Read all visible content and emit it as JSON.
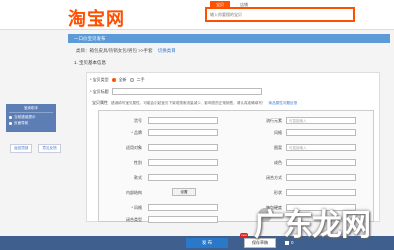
{
  "header": {
    "logo": "淘宝网",
    "search_tabs": [
      "宝贝",
      "店铺"
    ],
    "search_placeholder": "输入你要搜的宝贝"
  },
  "bluebar": {
    "title": "一口价宝贝发布"
  },
  "breadcrumb": {
    "text": "类目：箱包皮具/热销女包/男包 >>手套",
    "link": "切换类目"
  },
  "section": {
    "title": "1. 宝贝基本信息"
  },
  "leftnav": {
    "title": "宝卖助手",
    "items": [
      "当前错误提示",
      "页面导航"
    ]
  },
  "sidebtns": [
    "返回顶部",
    "意见反馈"
  ],
  "form": {
    "type_label": "* 宝贝类型",
    "type_options": [
      "全新",
      "二手"
    ],
    "title_label": "* 宝贝标题",
    "attr_label": "宝贝属性",
    "attr_note": "错误填写宝贝属性，可能会引起宝贝下架或搜索流量减少，影响您的正常销售，请认真准确填写！",
    "attr_link": "商品属性问题反馈"
  },
  "attributes": {
    "left": [
      {
        "label": "货号",
        "value": ""
      },
      {
        "label": "* 品牌",
        "value": ""
      },
      {
        "label": "适用对象",
        "value": ""
      },
      {
        "label": "性别",
        "value": ""
      },
      {
        "label": "款式",
        "value": ""
      },
      {
        "label": "内部结构",
        "value": "设置"
      },
      {
        "label": "* 风格",
        "value": ""
      },
      {
        "label": "闭合类型",
        "value": ""
      }
    ],
    "right": [
      {
        "label": "流行元素",
        "value": "可直接输入"
      },
      {
        "label": "风格",
        "value": ""
      },
      {
        "label": "图案",
        "value": "可直接输入"
      },
      {
        "label": "成色",
        "value": ""
      },
      {
        "label": "闭合方式",
        "value": ""
      },
      {
        "label": "形状",
        "value": ""
      },
      {
        "label": "箱包硬度",
        "value": ""
      }
    ]
  },
  "footer": {
    "publish": "发 布",
    "save": "保存草稿",
    "badge": "new",
    "count": "0"
  },
  "watermark": "广东龙网"
}
